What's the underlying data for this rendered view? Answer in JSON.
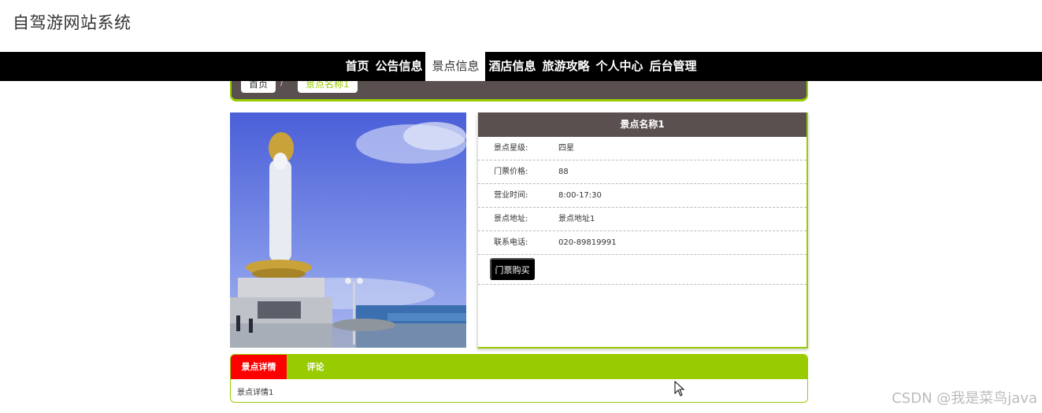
{
  "site": {
    "title": "自驾游网站系统"
  },
  "nav": {
    "items": [
      {
        "label": "首页"
      },
      {
        "label": "公告信息"
      },
      {
        "label": "景点信息"
      },
      {
        "label": "酒店信息"
      },
      {
        "label": "旅游攻略"
      },
      {
        "label": "个人中心"
      },
      {
        "label": "后台管理"
      }
    ],
    "active_index": 2
  },
  "breadcrumb": {
    "home": "首页",
    "separator": "/",
    "current": "景点名称1"
  },
  "spot": {
    "name": "景点名称1",
    "fields": [
      {
        "label": "景点星级:",
        "value": "四星"
      },
      {
        "label": "门票价格:",
        "value": "88"
      },
      {
        "label": "营业时间:",
        "value": "8:00-17:30"
      },
      {
        "label": "景点地址:",
        "value": "景点地址1"
      },
      {
        "label": "联系电话:",
        "value": "020-89819991"
      }
    ],
    "buy_label": "门票购买"
  },
  "tabs": {
    "items": [
      {
        "label": "景点详情"
      },
      {
        "label": "评论"
      }
    ],
    "content": "景点详情1"
  },
  "watermark": "CSDN @我是菜鸟java",
  "colors": {
    "nav_bg": "#000000",
    "accent_green": "#99cc00",
    "header_brown": "#5b5050",
    "active_tab_red": "#ff0000"
  }
}
